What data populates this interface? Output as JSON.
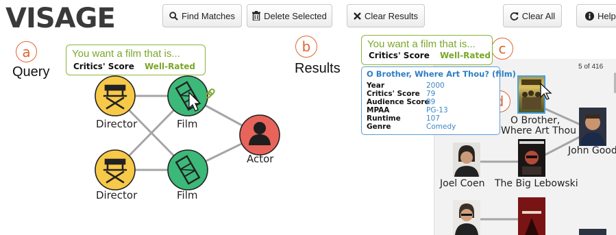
{
  "toolbar": {
    "logo": "VISAGE",
    "find_matches": "Find Matches",
    "delete_selected": "Delete Selected",
    "clear_results": "Clear Results",
    "clear_all": "Clear All",
    "help": "Help"
  },
  "annotations": {
    "a": "a",
    "b": "b",
    "c": "c",
    "d": "d"
  },
  "section_labels": {
    "query": "Query",
    "results": "Results"
  },
  "query_box": {
    "title": "You want a film that is...",
    "key": "Critics' Score",
    "value": "Well-Rated"
  },
  "results_box": {
    "title": "You want a film that is...",
    "key": "Critics' Score",
    "value": "Well-Rated"
  },
  "query_nodes": {
    "director1": "Director",
    "film1": "Film",
    "actor": "Actor",
    "director2": "Director",
    "film2": "Film"
  },
  "info_card": {
    "title": "O Brother, Where Art Thou? (film)",
    "rows": [
      {
        "key": "Year",
        "value": "2000"
      },
      {
        "key": "Critics' Score",
        "value": "79"
      },
      {
        "key": "Audience Score",
        "value": "89"
      },
      {
        "key": "MPAA",
        "value": "PG-13"
      },
      {
        "key": "Runtime",
        "value": "107"
      },
      {
        "key": "Genre",
        "value": "Comedy"
      }
    ]
  },
  "results": {
    "count": "5 of 416",
    "films": [
      "O Brother,",
      "Where Art Thou",
      "The Big Lebowski"
    ],
    "people": [
      "John Goodı",
      "Joel Coen"
    ]
  },
  "colors": {
    "director": "#f7c948",
    "film": "#3cb878",
    "actor": "#e8645a",
    "accent_orange": "#e0632e",
    "accent_green": "#7aa72a",
    "accent_blue": "#2d7ec4"
  }
}
